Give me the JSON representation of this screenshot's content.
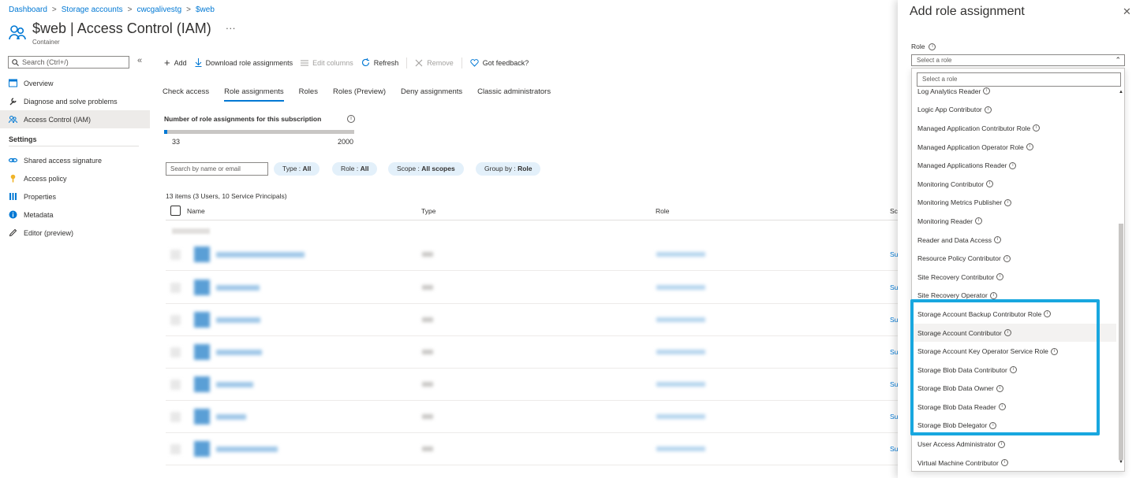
{
  "breadcrumb": [
    "Dashboard",
    "Storage accounts",
    "cwcgalivestg",
    "$web"
  ],
  "header": {
    "title": "$web | Access Control (IAM)",
    "subtitle": "Container",
    "more": "···"
  },
  "sidebar": {
    "search_placeholder": "Search (Ctrl+/)",
    "collapse": "«",
    "items": [
      {
        "label": "Overview",
        "icon": "overview-icon"
      },
      {
        "label": "Diagnose and solve problems",
        "icon": "wrench-icon"
      },
      {
        "label": "Access Control (IAM)",
        "icon": "people-icon",
        "active": true
      }
    ],
    "section": "Settings",
    "settings_items": [
      {
        "label": "Shared access signature",
        "icon": "link-icon"
      },
      {
        "label": "Access policy",
        "icon": "key-icon"
      },
      {
        "label": "Properties",
        "icon": "properties-icon"
      },
      {
        "label": "Metadata",
        "icon": "info-icon"
      },
      {
        "label": "Editor (preview)",
        "icon": "pencil-icon"
      }
    ]
  },
  "toolbar": {
    "add": "Add",
    "download": "Download role assignments",
    "edit_columns": "Edit columns",
    "refresh": "Refresh",
    "remove": "Remove",
    "feedback": "Got feedback?"
  },
  "tabs": [
    "Check access",
    "Role assignments",
    "Roles",
    "Roles (Preview)",
    "Deny assignments",
    "Classic administrators"
  ],
  "stats": {
    "title": "Number of role assignments for this subscription",
    "current": "33",
    "max": "2000",
    "fill_fraction": 0.0165
  },
  "filters": {
    "search_placeholder": "Search by name or email",
    "type_label": "Type : ",
    "type_value": "All",
    "role_label": "Role : ",
    "role_value": "All",
    "scope_label": "Scope : ",
    "scope_value": "All scopes",
    "group_label": "Group by : ",
    "group_value": "Role"
  },
  "table": {
    "count": "13 items (3 Users, 10 Service Principals)",
    "columns": {
      "name": "Name",
      "type": "Type",
      "role": "Role",
      "scope": "Sc"
    },
    "row_scope": "Su"
  },
  "panel": {
    "title": "Add role assignment",
    "close": "✕",
    "role_label": "Role",
    "select_placeholder": "Select a role",
    "filter_placeholder": "Select a role",
    "roles": [
      "Log Analytics Reader",
      "Logic App Contributor",
      "Managed Application Contributor Role",
      "Managed Application Operator Role",
      "Managed Applications Reader",
      "Monitoring Contributor",
      "Monitoring Metrics Publisher",
      "Monitoring Reader",
      "Reader and Data Access",
      "Resource Policy Contributor",
      "Site Recovery Contributor",
      "Site Recovery Operator",
      "Storage Account Backup Contributor Role",
      "Storage Account Contributor",
      "Storage Account Key Operator Service Role",
      "Storage Blob Data Contributor",
      "Storage Blob Data Owner",
      "Storage Blob Data Reader",
      "Storage Blob Delegator",
      "User Access Administrator",
      "Virtual Machine Contributor"
    ]
  },
  "colors": {
    "accent": "#0078d4",
    "highlight": "#18a7df"
  }
}
